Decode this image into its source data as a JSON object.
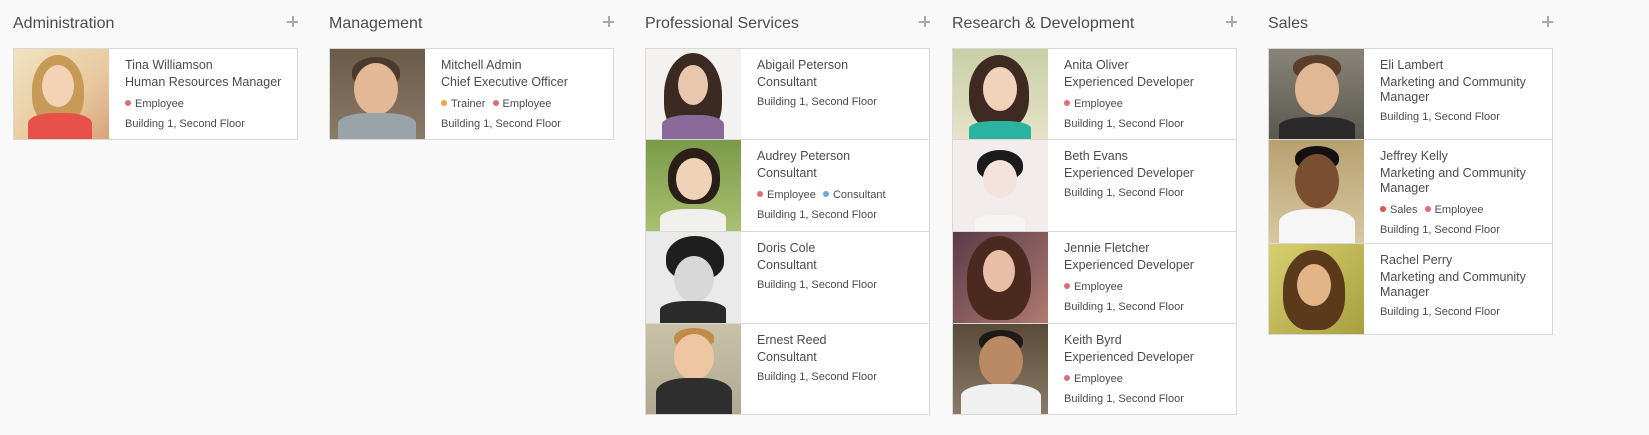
{
  "columns": [
    {
      "title": "Administration",
      "employees": [
        {
          "name": "Tina Williamson",
          "job": "Human Resources Manager",
          "tags": [
            {
              "label": "Employee",
              "color": "#e06c75"
            }
          ],
          "location": "Building 1, Second Floor",
          "avatar_icon": "woman-photo"
        }
      ]
    },
    {
      "title": "Management",
      "employees": [
        {
          "name": "Mitchell Admin",
          "job": "Chief Executive Officer",
          "tags": [
            {
              "label": "Trainer",
              "color": "#f0a04b"
            },
            {
              "label": "Employee",
              "color": "#e06c75"
            }
          ],
          "location": "Building 1, Second Floor",
          "avatar_icon": "man-photo"
        }
      ]
    },
    {
      "title": "Professional Services",
      "employees": [
        {
          "name": "Abigail Peterson",
          "job": "Consultant",
          "tags": [],
          "location": "Building 1, Second Floor",
          "avatar_icon": "woman-photo"
        },
        {
          "name": "Audrey Peterson",
          "job": "Consultant",
          "tags": [
            {
              "label": "Employee",
              "color": "#e06c75"
            },
            {
              "label": "Consultant",
              "color": "#6fa8dc"
            }
          ],
          "location": "Building 1, Second Floor",
          "avatar_icon": "woman-photo"
        },
        {
          "name": "Doris Cole",
          "job": "Consultant",
          "tags": [],
          "location": "Building 1, Second Floor",
          "avatar_icon": "woman-photo"
        },
        {
          "name": "Ernest Reed",
          "job": "Consultant",
          "tags": [],
          "location": "Building 1, Second Floor",
          "avatar_icon": "man-photo"
        }
      ]
    },
    {
      "title": "Research & Development",
      "employees": [
        {
          "name": "Anita Oliver",
          "job": "Experienced Developer",
          "tags": [
            {
              "label": "Employee",
              "color": "#e06c75"
            }
          ],
          "location": "Building 1, Second Floor",
          "avatar_icon": "woman-photo"
        },
        {
          "name": "Beth Evans",
          "job": "Experienced Developer",
          "tags": [],
          "location": "Building 1, Second Floor",
          "avatar_icon": "woman-photo"
        },
        {
          "name": "Jennie Fletcher",
          "job": "Experienced Developer",
          "tags": [
            {
              "label": "Employee",
              "color": "#e06c75"
            }
          ],
          "location": "Building 1, Second Floor",
          "avatar_icon": "woman-photo"
        },
        {
          "name": "Keith Byrd",
          "job": "Experienced Developer",
          "tags": [
            {
              "label": "Employee",
              "color": "#e06c75"
            }
          ],
          "location": "Building 1, Second Floor",
          "avatar_icon": "man-photo"
        }
      ]
    },
    {
      "title": "Sales",
      "employees": [
        {
          "name": "Eli Lambert",
          "job": "Marketing and Community Manager",
          "tags": [],
          "location": "Building 1, Second Floor",
          "avatar_icon": "man-photo"
        },
        {
          "name": "Jeffrey Kelly",
          "job": "Marketing and Community Manager",
          "tags": [
            {
              "label": "Sales",
              "color": "#e05252"
            },
            {
              "label": "Employee",
              "color": "#e06c75"
            }
          ],
          "location": "Building 1, Second Floor",
          "avatar_icon": "man-photo"
        },
        {
          "name": "Rachel Perry",
          "job": "Marketing and Community Manager",
          "tags": [],
          "location": "Building 1, Second Floor",
          "avatar_icon": "woman-photo"
        }
      ]
    }
  ]
}
